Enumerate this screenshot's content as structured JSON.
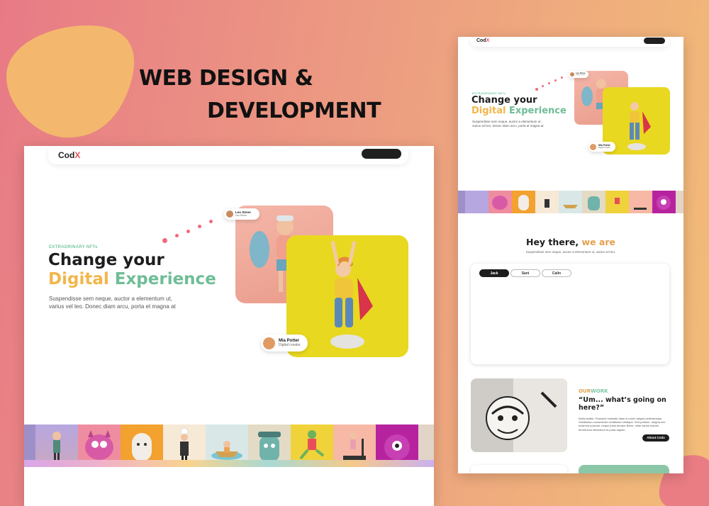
{
  "banner": {
    "headline_line1": "WEB DESIGN &",
    "headline_line2": "DEVELOPMENT"
  },
  "desktop": {
    "logo_text": "Cod",
    "logo_accent": "X",
    "hero": {
      "eyebrow": "EXTRADRINARY NFTs",
      "title_line1": "Change your",
      "title_word1": "Digital",
      "title_word2": "Experience",
      "subtitle_line1": "Suspendisse sem neque, auctor a elementum ut,",
      "subtitle_line2": "varius vel leo. Donec diam arcu, porta et magna at"
    },
    "creator_1": {
      "name": "Leo Stone",
      "role": "Leo Stone"
    },
    "creator_2": {
      "name": "Mia Potter",
      "role": "Digital creator"
    }
  },
  "mobile": {
    "logo_text": "Cod",
    "logo_accent": "X",
    "hero": {
      "eyebrow": "EXTRADRINARY NFTs",
      "title_line1": "Change your",
      "title_word1": "Digital",
      "title_word2": "Experience",
      "subtitle_line1": "Suspendisse sem neque, auctor a elementum ut,",
      "subtitle_line2": "varius vel leo. Donec diam arcu, porta et magna at"
    },
    "creator_1": {
      "name": "Leo Stone",
      "role": "Digital creator"
    },
    "creator_2": {
      "name": "Mia Potter",
      "role": "Digital creator"
    },
    "team": {
      "title_start": "Hey there,",
      "title_accent": "we are",
      "subtitle": "Suspendisse sem neque, auctor a elementum ut, varius vel leo.",
      "tabs": [
        "Jack",
        "Sani",
        "Calin"
      ]
    },
    "work": {
      "eyebrow_1": "OUR",
      "eyebrow_2": "WORK",
      "title_line1": "“Um... what’s going on",
      "title_line2": "here?”",
      "body": "Nulla facilisi. Praesent molestie diam eu enim aliquet pellentesque. Vestibulum consectetur vestibulum tristique. Sed pretium, magna nec euismod pulvinar, neque justo tempor libero, vitae varius mauris fermentum bibendum et porta sapien.",
      "button_label": "About Codx"
    }
  },
  "colors": {
    "accent_red": "#e9525e",
    "accent_green": "#79c7a1",
    "accent_orange": "#f2b64a",
    "dark": "#1d1d1d"
  }
}
